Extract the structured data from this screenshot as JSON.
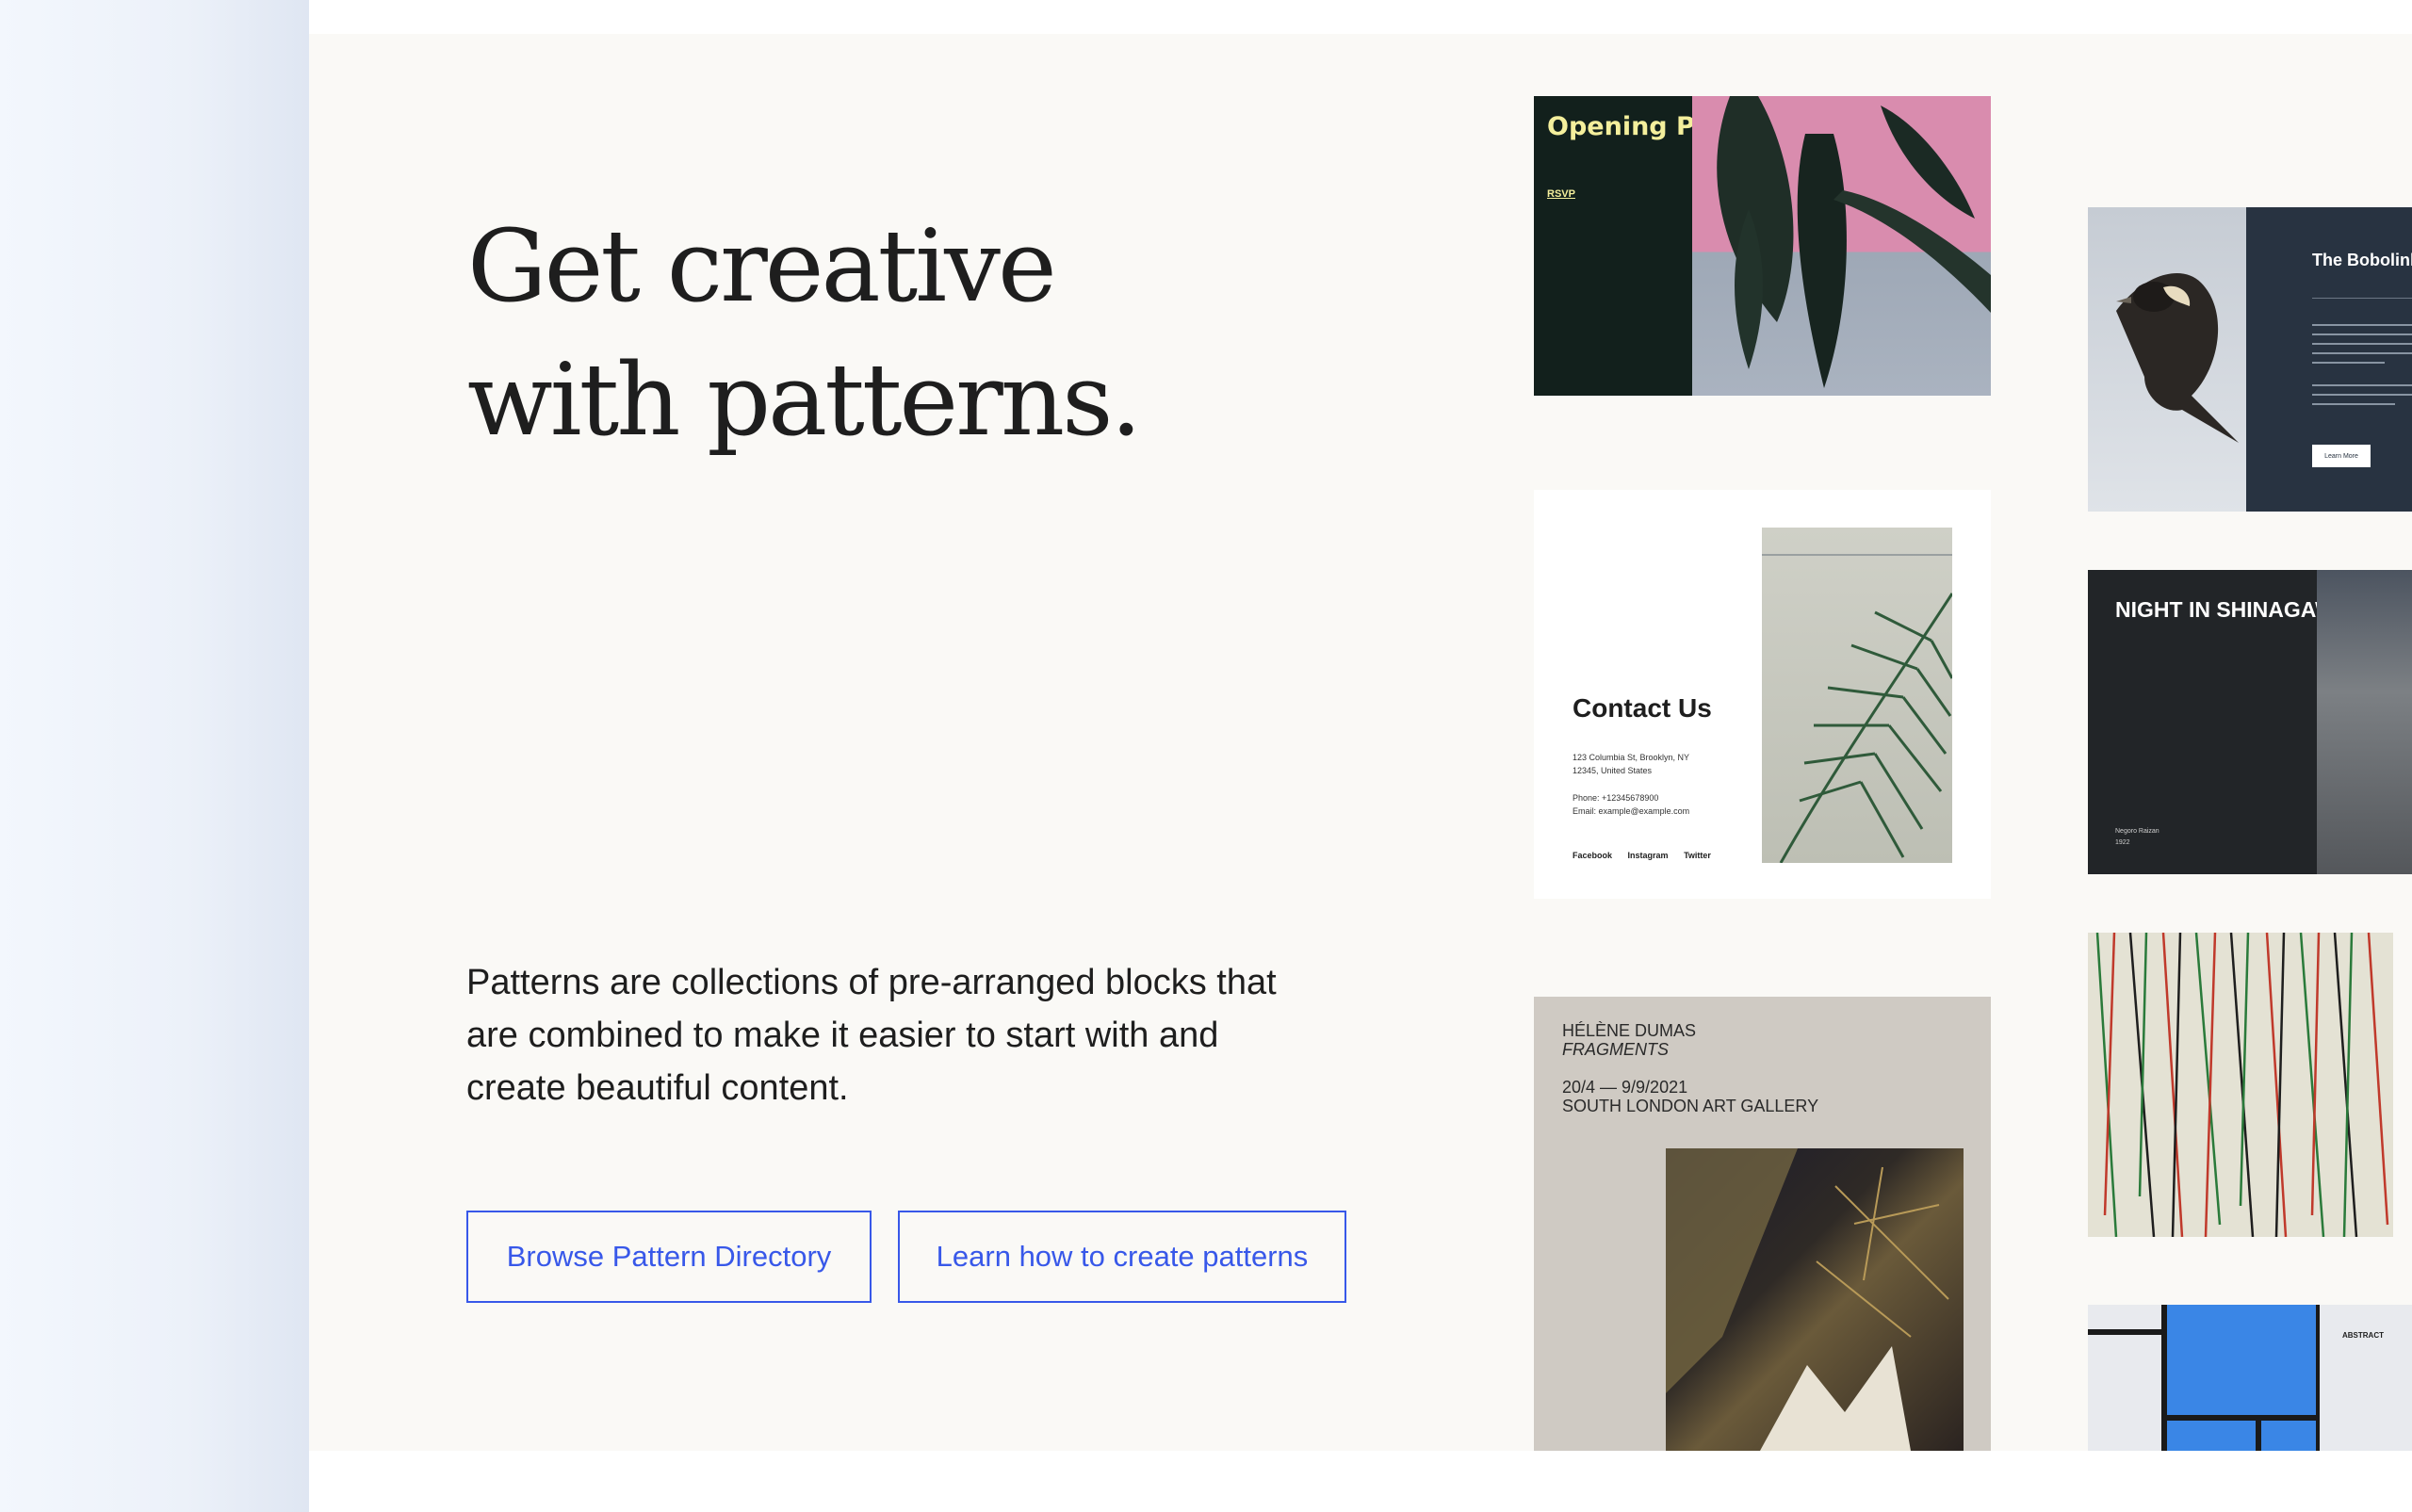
{
  "hero": {
    "title_line1": "Get creative",
    "title_line2": "with patterns.",
    "description": "Patterns are collections of pre-arranged blocks that are combined to make it easier to start with and create beautiful content.",
    "browse_button": "Browse Pattern Directory",
    "learn_button": "Learn how to create patterns"
  },
  "patterns": {
    "opening_party": {
      "title": "Opening Party",
      "link": "RSVP"
    },
    "contact": {
      "title": "Contact Us",
      "address1": "123 Columbia St, Brooklyn, NY",
      "address2": "12345, United States",
      "phone": "Phone: +12345678900",
      "email": "Email: example@example.com",
      "social": [
        "Facebook",
        "Instagram",
        "Twitter"
      ]
    },
    "fragments": {
      "artist": "HÉLÈNE DUMAS",
      "title": "FRAGMENTS",
      "dates": "20/4 — 9/9/2021",
      "venue": "SOUTH LONDON ART GALLERY"
    },
    "bobolink": {
      "title": "The Bobolink",
      "button": "Learn More"
    },
    "shinagawa": {
      "title": "NIGHT IN SHINAGAWA",
      "artist": "Negoro Raizan",
      "year": "1922"
    },
    "abstract": {
      "label": "ABSTRACT"
    }
  },
  "colors": {
    "accent": "#3858e9",
    "panel_bg": "#faf9f6",
    "text": "#1e1e1e"
  }
}
